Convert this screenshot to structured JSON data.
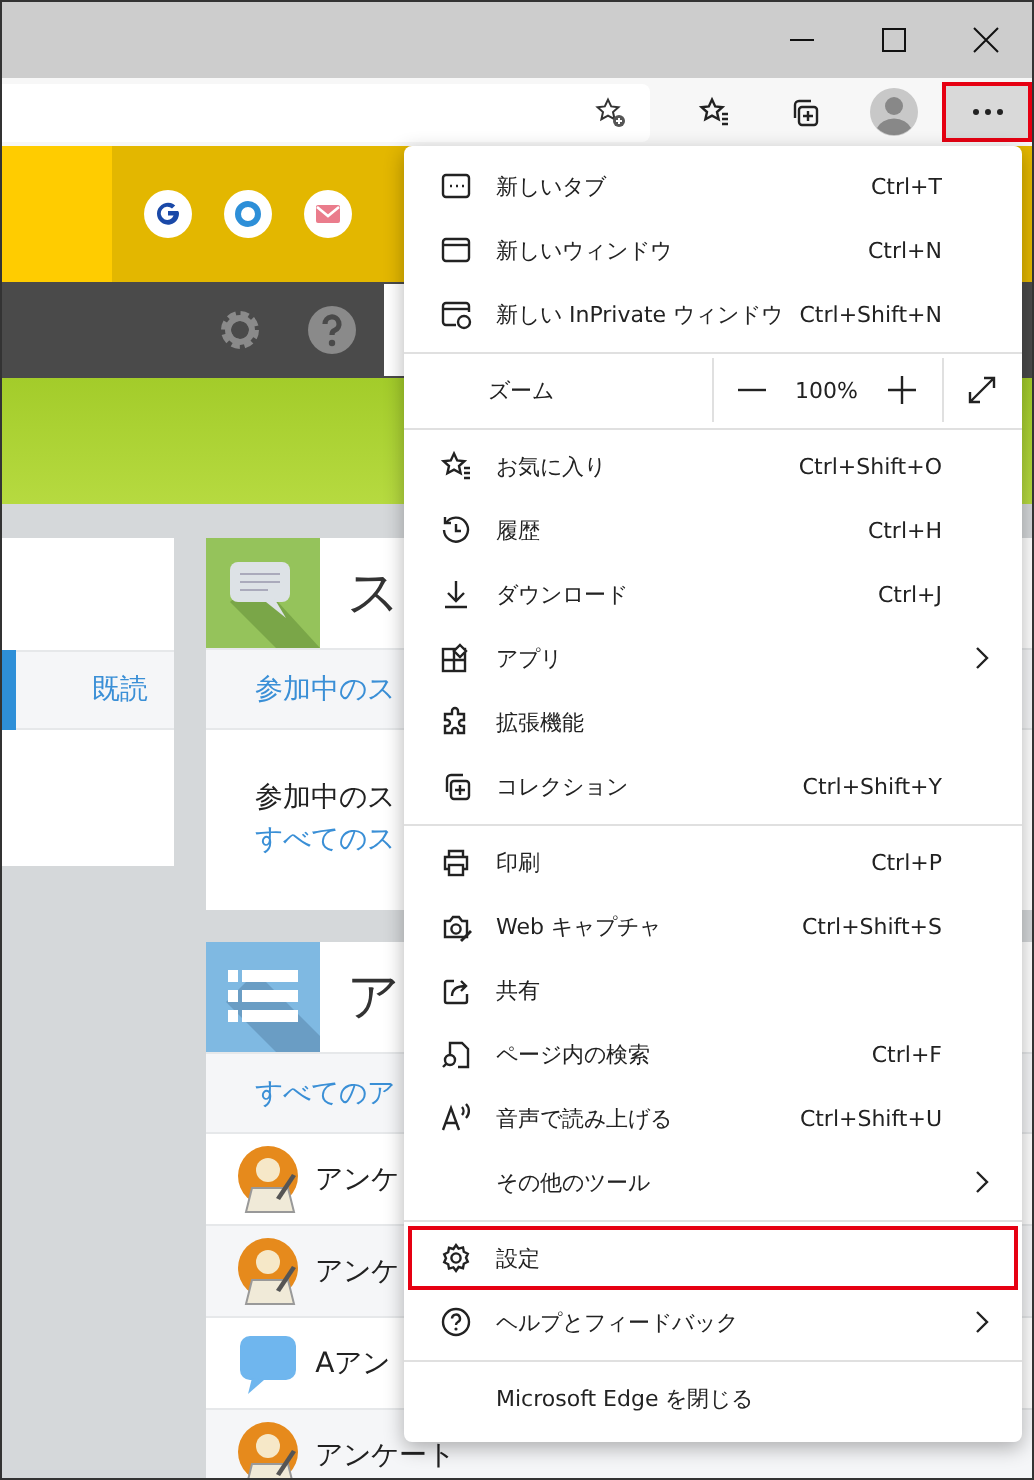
{
  "toolbar": {
    "more_button": {
      "highlighted": true
    }
  },
  "page": {
    "left_card": {
      "tab": "既読"
    },
    "cards": [
      {
        "kind": "chat",
        "title": "ス",
        "link": "参加中のス",
        "lines": [
          {
            "kind": "text",
            "text": "参加中のス"
          },
          {
            "kind": "link",
            "text": "すべてのス"
          }
        ]
      },
      {
        "kind": "list",
        "title": "ア",
        "link": "すべてのア",
        "rows": [
          {
            "kind": "survey",
            "text": "アンケ"
          },
          {
            "kind": "survey",
            "text": "アンケ"
          },
          {
            "kind": "bubble",
            "text": "Aアン"
          },
          {
            "kind": "survey",
            "text": "アンケート"
          }
        ]
      }
    ]
  },
  "menu": {
    "items": [
      {
        "kind": "item",
        "label": "新しいタブ",
        "shortcut": "Ctrl+T",
        "submenu": false,
        "highlighted": false
      },
      {
        "kind": "item",
        "label": "新しいウィンドウ",
        "shortcut": "Ctrl+N",
        "submenu": false,
        "highlighted": false
      },
      {
        "kind": "item",
        "label": "新しい InPrivate ウィンドウ",
        "shortcut": "Ctrl+Shift+N",
        "submenu": false,
        "highlighted": false
      },
      {
        "kind": "separator"
      },
      {
        "kind": "zoom",
        "label": "ズーム",
        "value": "100%"
      },
      {
        "kind": "separator"
      },
      {
        "kind": "item",
        "label": "お気に入り",
        "shortcut": "Ctrl+Shift+O",
        "submenu": false,
        "highlighted": false
      },
      {
        "kind": "item",
        "label": "履歴",
        "shortcut": "Ctrl+H",
        "submenu": false,
        "highlighted": false
      },
      {
        "kind": "item",
        "label": "ダウンロード",
        "shortcut": "Ctrl+J",
        "submenu": false,
        "highlighted": false
      },
      {
        "kind": "item",
        "label": "アプリ",
        "submenu": true,
        "highlighted": false
      },
      {
        "kind": "item",
        "label": "拡張機能",
        "submenu": false,
        "highlighted": false
      },
      {
        "kind": "item",
        "label": "コレクション",
        "shortcut": "Ctrl+Shift+Y",
        "submenu": false,
        "highlighted": false
      },
      {
        "kind": "separator"
      },
      {
        "kind": "item",
        "label": "印刷",
        "shortcut": "Ctrl+P",
        "submenu": false,
        "highlighted": false
      },
      {
        "kind": "item",
        "label": "Web キャプチャ",
        "shortcut": "Ctrl+Shift+S",
        "submenu": false,
        "highlighted": false
      },
      {
        "kind": "item",
        "label": "共有",
        "submenu": false,
        "highlighted": false
      },
      {
        "kind": "item",
        "label": "ページ内の検索",
        "shortcut": "Ctrl+F",
        "submenu": false,
        "highlighted": false
      },
      {
        "kind": "item",
        "label": "音声で読み上げる",
        "shortcut": "Ctrl+Shift+U",
        "submenu": false,
        "highlighted": false
      },
      {
        "kind": "item",
        "label": "その他のツール",
        "submenu": true,
        "highlighted": false
      },
      {
        "kind": "separator"
      },
      {
        "kind": "item",
        "label": "設定",
        "submenu": false,
        "highlighted": true
      },
      {
        "kind": "item",
        "label": "ヘルプとフィードバック",
        "submenu": true,
        "highlighted": false
      },
      {
        "kind": "separator"
      },
      {
        "kind": "item",
        "label": "Microsoft Edge を閉じる",
        "submenu": false,
        "highlighted": false
      }
    ]
  }
}
